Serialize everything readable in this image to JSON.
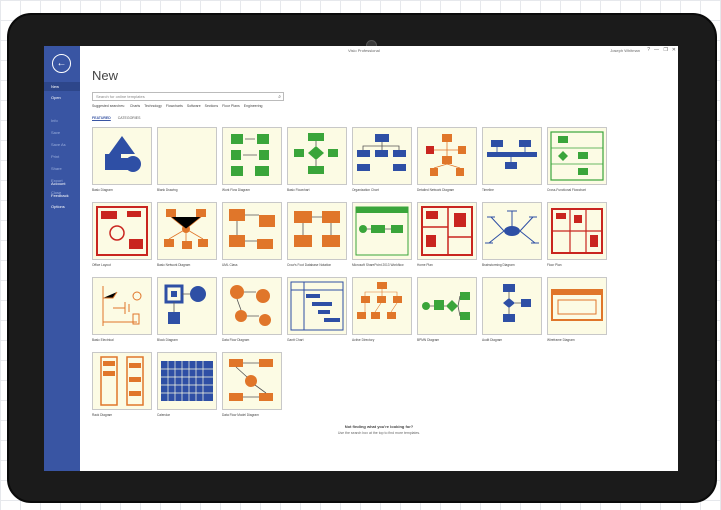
{
  "window": {
    "app_title": "Visio Professional",
    "user": "Joseph Whitman",
    "controls": [
      "?",
      "—",
      "❐",
      "✕"
    ]
  },
  "sidebar": {
    "back_icon": "back-arrow-icon",
    "items": [
      {
        "label": "New",
        "state": "active"
      },
      {
        "label": "Open",
        "state": "normal"
      },
      {
        "label": "Info",
        "state": "dim"
      },
      {
        "label": "Save",
        "state": "dim"
      },
      {
        "label": "Save As",
        "state": "dim"
      },
      {
        "label": "Print",
        "state": "dim"
      },
      {
        "label": "Share",
        "state": "dim"
      },
      {
        "label": "Export",
        "state": "dim"
      },
      {
        "label": "Close",
        "state": "dim"
      },
      {
        "label": "Account",
        "state": "normal"
      },
      {
        "label": "Feedback",
        "state": "normal"
      },
      {
        "label": "Options",
        "state": "normal"
      }
    ]
  },
  "main": {
    "title": "New",
    "search_placeholder": "Search for online templates",
    "suggested_label": "Suggested searches:",
    "suggested": [
      "Charts",
      "Technology",
      "Flowcharts",
      "Software",
      "Sections",
      "Floor Plans",
      "Engineering"
    ],
    "tabs": [
      "FEATURED",
      "CATEGORIES"
    ],
    "active_tab": "FEATURED",
    "templates": [
      {
        "label": "Basic Diagram",
        "icon": "basic-shapes"
      },
      {
        "label": "Blank Drawing",
        "icon": "blank"
      },
      {
        "label": "Work Flow Diagram",
        "icon": "workflow"
      },
      {
        "label": "Basic Flowchart",
        "icon": "flowchart"
      },
      {
        "label": "Organization Chart",
        "icon": "org-chart"
      },
      {
        "label": "Detailed Network Diagram",
        "icon": "network-detailed"
      },
      {
        "label": "Timeline",
        "icon": "timeline"
      },
      {
        "label": "Cross-Functional Flowchart",
        "icon": "cross-functional"
      },
      {
        "label": "Office Layout",
        "icon": "office-layout"
      },
      {
        "label": "Basic Network Diagram",
        "icon": "network-basic"
      },
      {
        "label": "UML Class",
        "icon": "uml-class"
      },
      {
        "label": "Crow's Foot Database Notation",
        "icon": "crows-foot"
      },
      {
        "label": "Microsoft SharePoint 2013 Workflow",
        "icon": "sharepoint"
      },
      {
        "label": "Home Plan",
        "icon": "home-plan"
      },
      {
        "label": "Brainstorming Diagram",
        "icon": "brainstorm"
      },
      {
        "label": "Floor Plan",
        "icon": "floor-plan"
      },
      {
        "label": "Basic Electrical",
        "icon": "electrical"
      },
      {
        "label": "Block Diagram",
        "icon": "block"
      },
      {
        "label": "Data Flow Diagram",
        "icon": "data-flow"
      },
      {
        "label": "Gantt Chart",
        "icon": "gantt"
      },
      {
        "label": "Active Directory",
        "icon": "active-directory"
      },
      {
        "label": "BPMN Diagram",
        "icon": "bpmn"
      },
      {
        "label": "Audit Diagram",
        "icon": "audit"
      },
      {
        "label": "Wireframe Diagram",
        "icon": "wireframe"
      },
      {
        "label": "Rack Diagram",
        "icon": "rack"
      },
      {
        "label": "Calendar",
        "icon": "calendar"
      },
      {
        "label": "Data Flow Model Diagram",
        "icon": "data-flow-model"
      }
    ],
    "not_finding_title": "Not finding what you're looking for?",
    "not_finding_hint": "Use the search box at the top to find more templates."
  },
  "colors": {
    "sidebar": "#3955a3",
    "blue": "#2e4fa5",
    "green": "#3aa53a",
    "orange": "#e0762a",
    "red": "#c9251f",
    "thumb_bg": "#fcfbe4"
  }
}
